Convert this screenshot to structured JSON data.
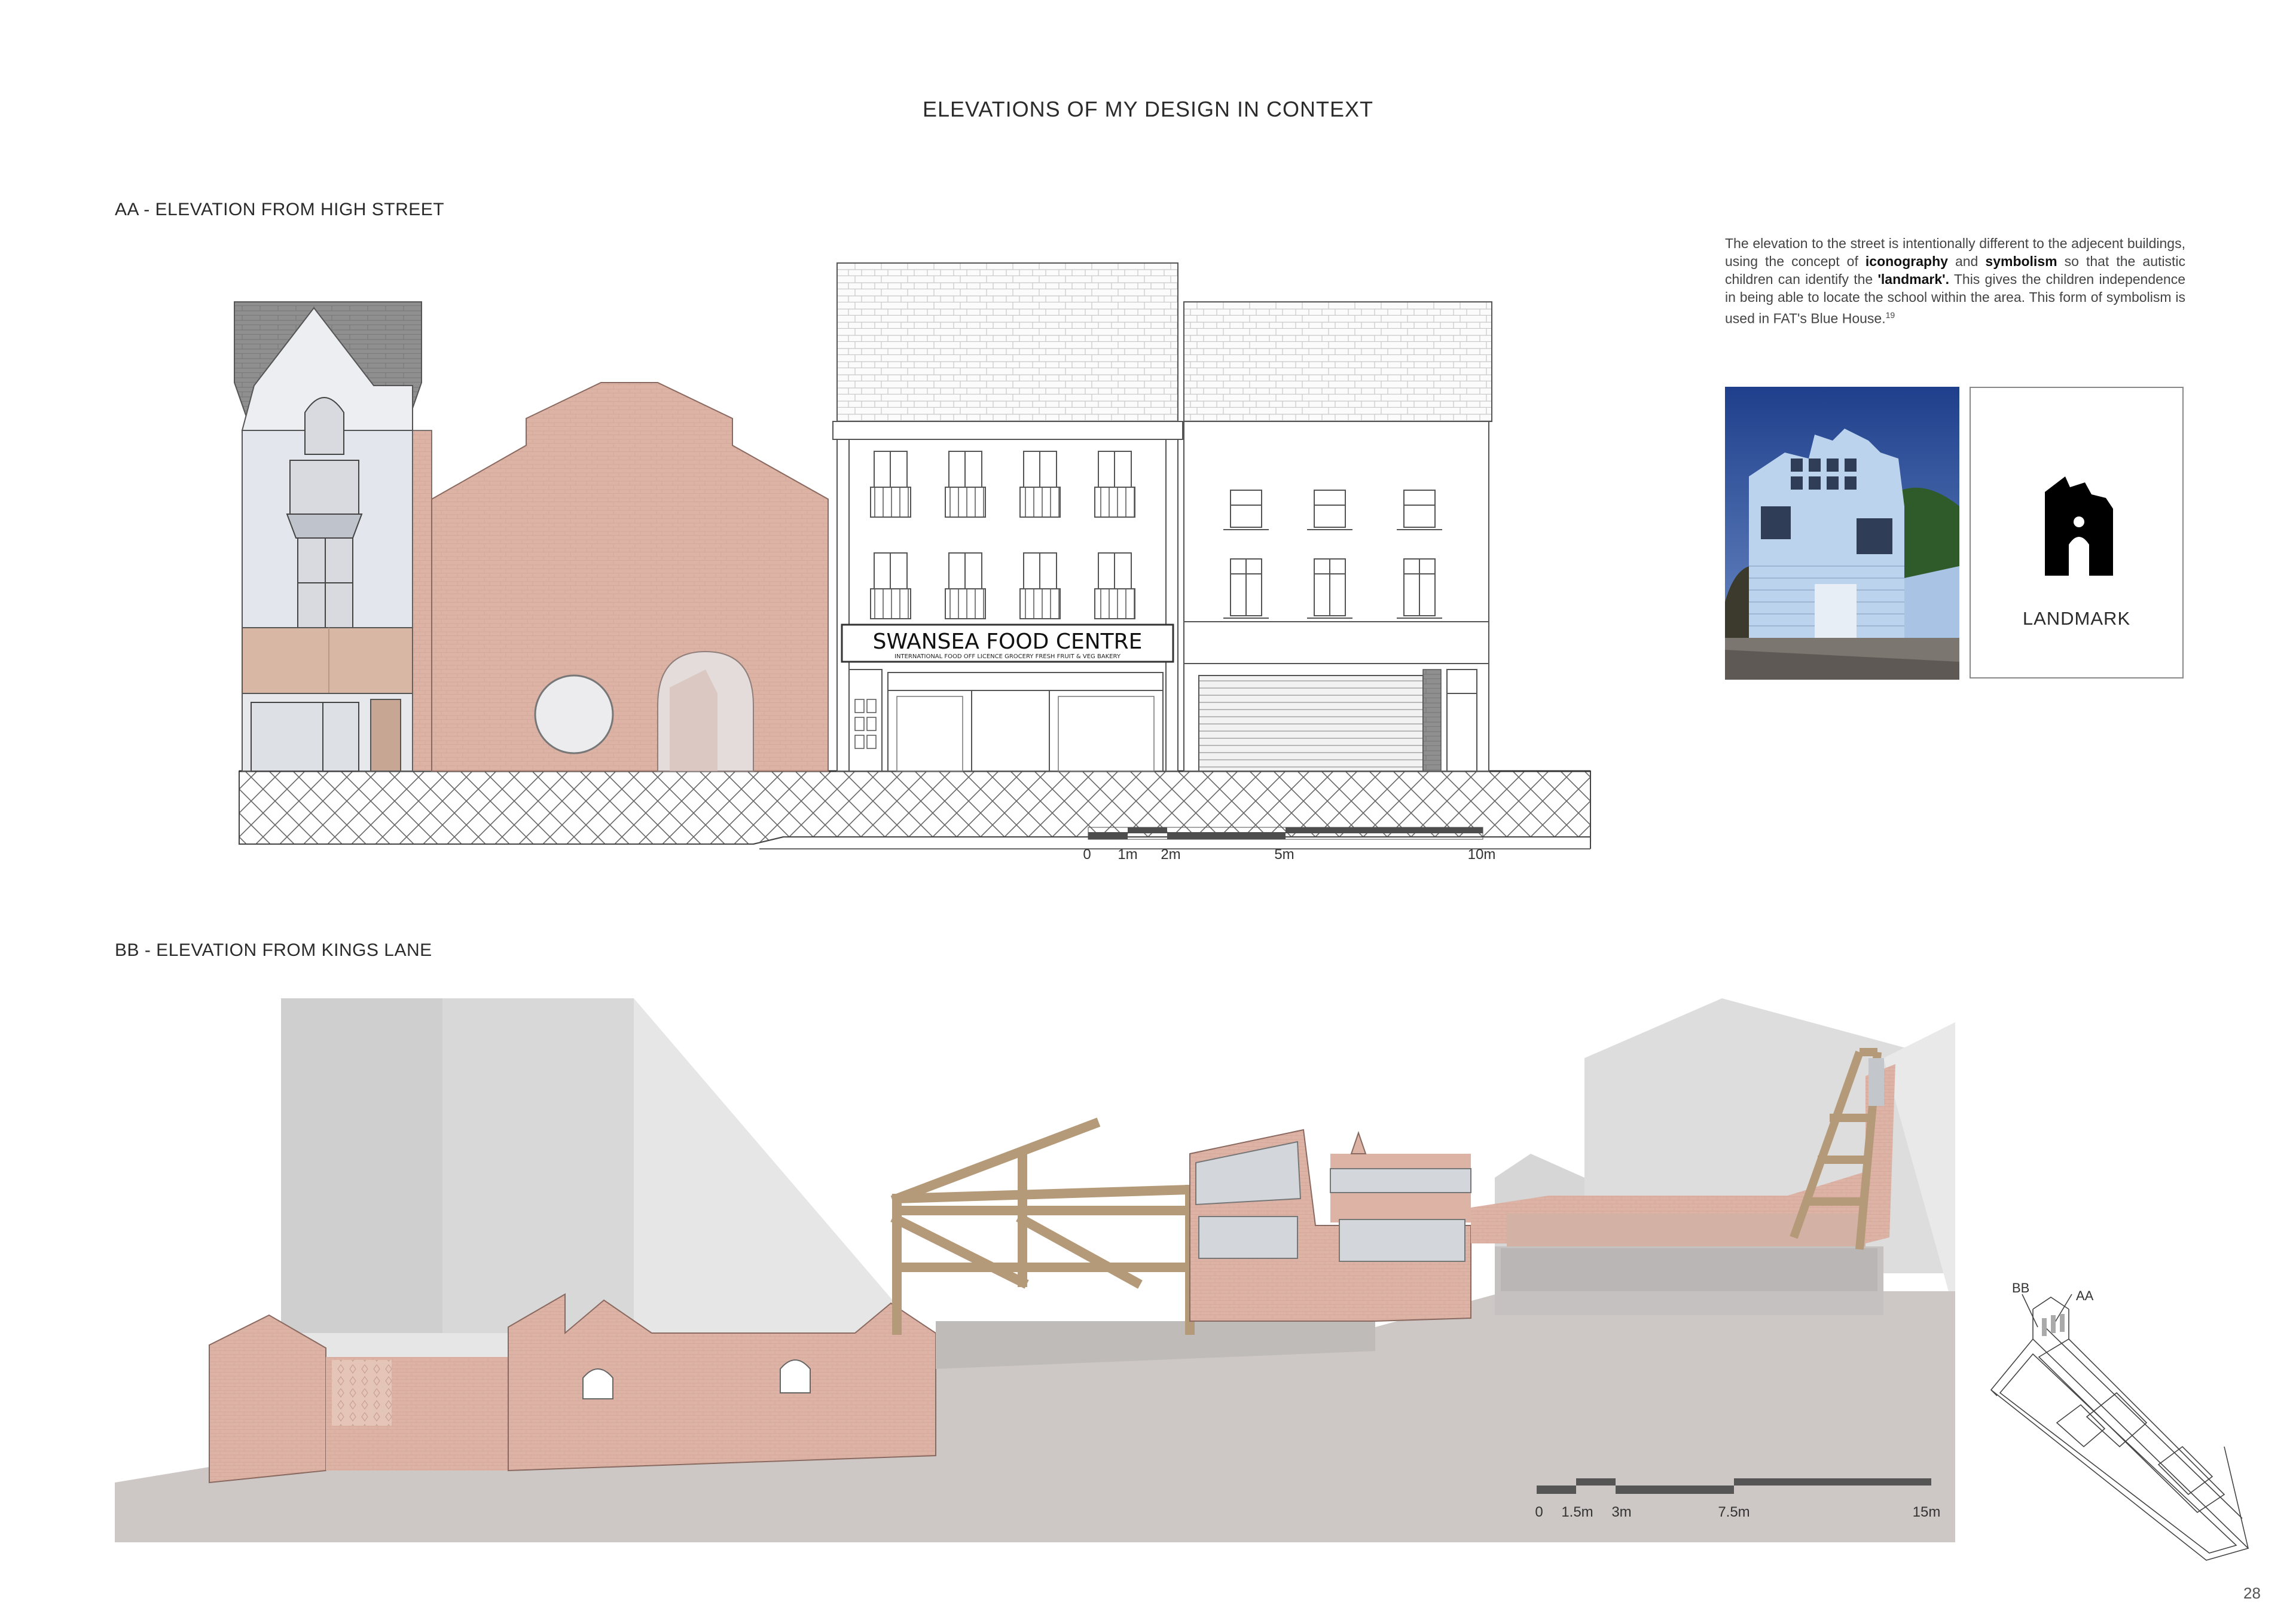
{
  "page": {
    "title": "ELEVATIONS OF MY DESIGN IN CONTEXT",
    "number": "28"
  },
  "section_aa": {
    "label": "AA - ELEVATION FROM HIGH STREET",
    "shop_sign": {
      "main": "SWANSEA FOOD CENTRE",
      "sub": "INTERNATIONAL FOOD   OFF LICENCE   GROCERY   FRESH FRUIT & VEG   BAKERY"
    },
    "scale_bar": [
      "0",
      "1m",
      "2m",
      "5m",
      "10m"
    ]
  },
  "section_bb": {
    "label": "BB - ELEVATION FROM KINGS LANE",
    "scale_bar": [
      "0",
      "1.5m",
      "3m",
      "7.5m",
      "15m"
    ],
    "key_plan_labels": [
      "BB",
      "AA"
    ]
  },
  "description": {
    "text_1": "The elevation to the street is intentionally different to the adjecent buildings, using the concept of ",
    "bold_1": "iconography",
    "text_2": " and ",
    "bold_2": "symbolism",
    "text_3": " so that the autistic children can identify the ",
    "bold_3": "'landmark'.",
    "text_4": " This gives the children independence in being able to locate the school within the area. This form of symbolism is used in FAT's Blue House.",
    "footnote": "19"
  },
  "landmark_card": {
    "label": "LANDMARK",
    "icon": "house-silhouette-icon"
  },
  "colors": {
    "brick": "#ddb3a6",
    "concrete": "#cdc8c6",
    "shadow_grey": "#dedede",
    "timber": "#b49a78",
    "glass": "#d3d6db",
    "blue_house": "#bcd3ee"
  }
}
